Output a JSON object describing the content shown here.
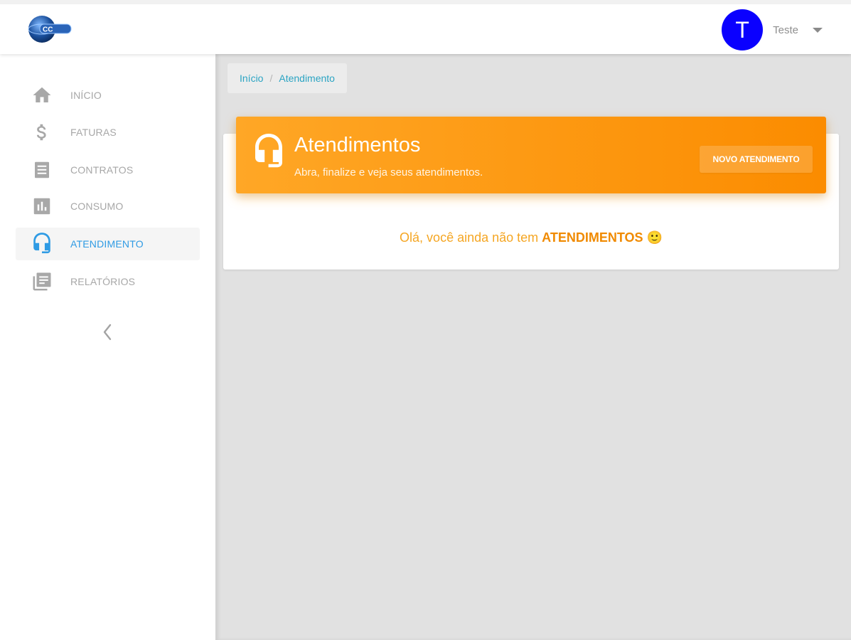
{
  "topbar": {
    "logo_text": "CC",
    "user": {
      "initial": "T",
      "name": "Teste",
      "avatar_color": "#0a00ff"
    }
  },
  "sidebar": {
    "items": [
      {
        "label": "INÍCIO",
        "icon": "home-icon",
        "active": false
      },
      {
        "label": "FATURAS",
        "icon": "dollar-icon",
        "active": false
      },
      {
        "label": "CONTRATOS",
        "icon": "document-icon",
        "active": false
      },
      {
        "label": "CONSUMO",
        "icon": "bar-chart-icon",
        "active": false
      },
      {
        "label": "ATENDIMENTO",
        "icon": "headset-icon",
        "active": true
      },
      {
        "label": "RELATÓRIOS",
        "icon": "reports-icon",
        "active": false
      }
    ],
    "collapse_icon": "chevron-left-icon"
  },
  "breadcrumb": {
    "home": "Início",
    "separator": "/",
    "current": "Atendimento"
  },
  "card": {
    "title": "Atendimentos",
    "subtitle": "Abra, finalize e veja seus atendimentos.",
    "button_label": "NOVO ATENDIMENTO",
    "empty_prefix": "Olá, você ainda não tem ",
    "empty_strong": "ATENDIMENTOS",
    "empty_emoji": "🙂"
  },
  "colors": {
    "accent_orange": "#fb8c00",
    "active_nav": "#2f9be4",
    "breadcrumb_link": "#2ba4c3",
    "content_bg": "#e1e1e1"
  }
}
